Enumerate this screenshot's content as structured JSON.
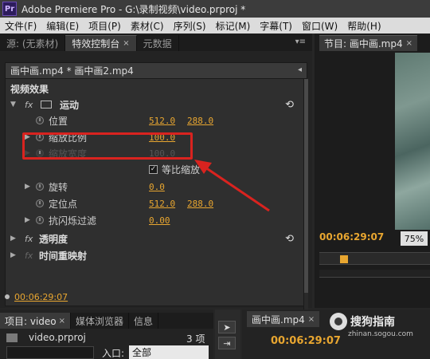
{
  "app": {
    "logo": "Pr",
    "title": "Adobe Premiere Pro - G:\\录制视频\\video.prproj *"
  },
  "menu": [
    "文件(F)",
    "编辑(E)",
    "项目(P)",
    "素材(C)",
    "序列(S)",
    "标记(M)",
    "字幕(T)",
    "窗口(W)",
    "帮助(H)"
  ],
  "left_panel": {
    "tabs": [
      {
        "label": "源: (无素材)"
      },
      {
        "label": "特效控制台",
        "close": "×"
      },
      {
        "label": "元数据"
      }
    ],
    "menu_glyph": "▾≡",
    "clip_name": "画中画.mp4 * 画中画2.mp4",
    "clip_toggle": "◂",
    "section_title": "视频效果",
    "effects": {
      "motion": {
        "fx": "fx",
        "label": "运动",
        "reset": "⟲"
      },
      "position": {
        "label": "位置",
        "x": "512.0",
        "y": "288.0"
      },
      "scale": {
        "label": "缩放比例",
        "value": "100.0"
      },
      "scale_width": {
        "label": "缩放宽度",
        "value": "100.0"
      },
      "uniform_scale": {
        "label": "等比缩放",
        "checked": "✓"
      },
      "rotation": {
        "label": "旋转",
        "value": "0.0"
      },
      "anchor": {
        "label": "定位点",
        "x": "512.0",
        "y": "288.0"
      },
      "flicker": {
        "label": "抗闪烁过滤",
        "value": "0.00"
      },
      "opacity": {
        "fx": "fx",
        "label": "透明度",
        "reset": "⟲"
      },
      "time_remap": {
        "fx": "fx",
        "label": "时间重映射"
      }
    },
    "current_time": "00:06:29:07"
  },
  "program_panel": {
    "tab": "节目: 画中画.mp4",
    "close": "×",
    "timecode": "00:06:29:07",
    "zoom": "75%"
  },
  "bottom_left": {
    "tabs": [
      {
        "label": "项目: video",
        "close": "×"
      },
      {
        "label": "媒体浏览器"
      },
      {
        "label": "信息"
      }
    ],
    "project_file": "video.prproj",
    "item_count": "3 项",
    "entry_label": "入口:",
    "entry_value": "全部"
  },
  "timeline": {
    "tab": "画中画.mp4",
    "close": "×",
    "timecode": "00:06:29:07"
  },
  "watermark": {
    "text": "搜狗指南",
    "sub": "zhinan.sogou.com"
  },
  "colors": {
    "accent_value": "#e8a630",
    "annotation": "#d9231f"
  }
}
